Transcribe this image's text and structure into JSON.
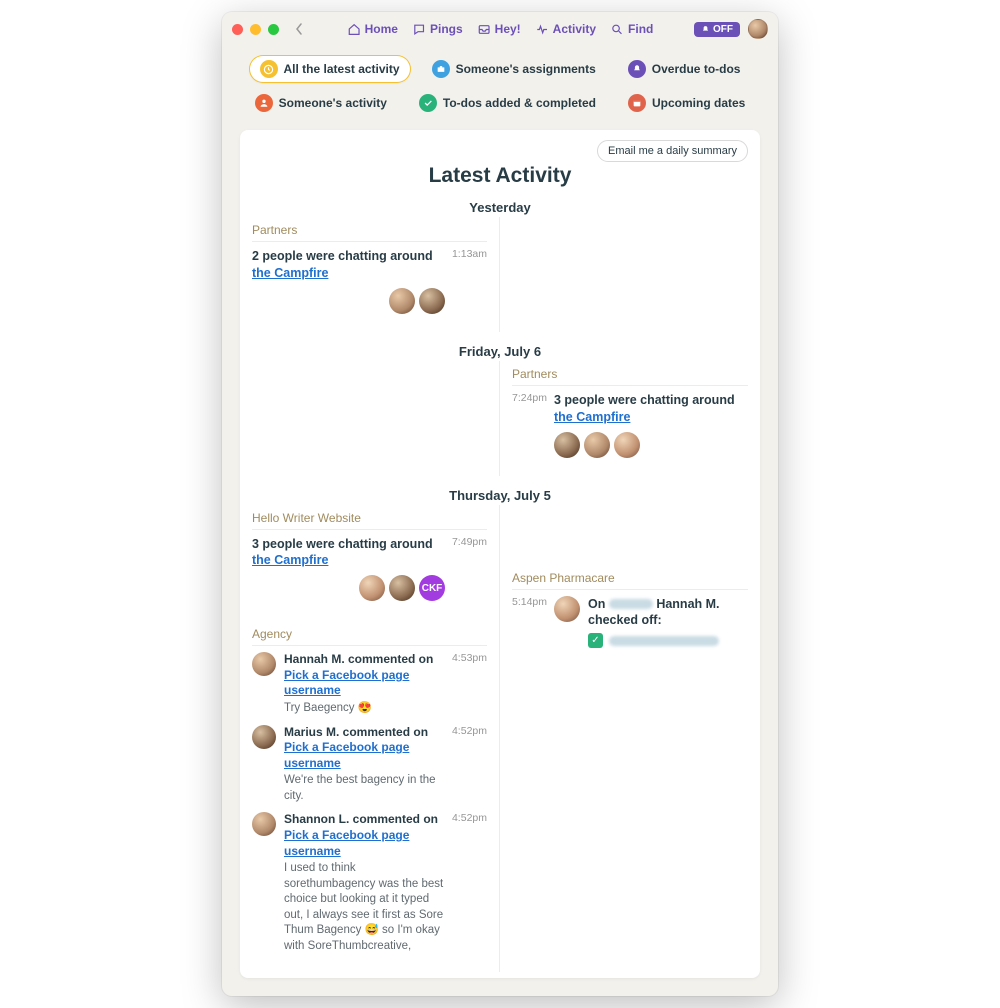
{
  "nav": {
    "home": "Home",
    "pings": "Pings",
    "hey": "Hey!",
    "activity": "Activity",
    "find": "Find",
    "off_badge": "OFF"
  },
  "filters": {
    "all_latest": "All the latest activity",
    "assignments": "Someone's assignments",
    "overdue": "Overdue to-dos",
    "someones_activity": "Someone's activity",
    "todos_added": "To-dos added & completed",
    "upcoming": "Upcoming dates"
  },
  "buttons": {
    "daily_summary": "Email me a daily summary"
  },
  "page_title": "Latest Activity",
  "days": {
    "yesterday": "Yesterday",
    "fri_jul6": "Friday, July 6",
    "thu_jul5": "Thursday, July 5"
  },
  "projects": {
    "partners": "Partners",
    "hello_writer": "Hello Writer Website",
    "agency": "Agency",
    "aspen": "Aspen Pharmacare"
  },
  "entries": {
    "y_partners": {
      "time": "1:13am",
      "text": "2 people were chatting around ",
      "link": "the Campfire"
    },
    "f6_partners": {
      "time": "7:24pm",
      "text": "3 people were chatting around ",
      "link": "the Campfire"
    },
    "t5_hello": {
      "time": "7:49pm",
      "text": "3 people were chatting around ",
      "link": "the Campfire",
      "badge": "CKF"
    },
    "t5_aspen": {
      "time": "5:14pm",
      "prefix": "On ",
      "suffix": " Hannah M. checked off:"
    },
    "ag1": {
      "time": "4:53pm",
      "head_a": "Hannah M. commented on ",
      "link": "Pick a Facebook page username",
      "body": "Try Baegency 😍"
    },
    "ag2": {
      "time": "4:52pm",
      "head_a": "Marius M. commented on ",
      "link": "Pick a Facebook page username",
      "body": "We're the best bagency in the city."
    },
    "ag3": {
      "time": "4:52pm",
      "head_a": "Shannon L. commented on ",
      "link": "Pick a Facebook page username",
      "body": "I used to think sorethumbagency was the best choice but looking at it typed out, I always see it first as Sore Thum Bagency 😅 so I'm okay with SoreThumbcreative,"
    }
  }
}
